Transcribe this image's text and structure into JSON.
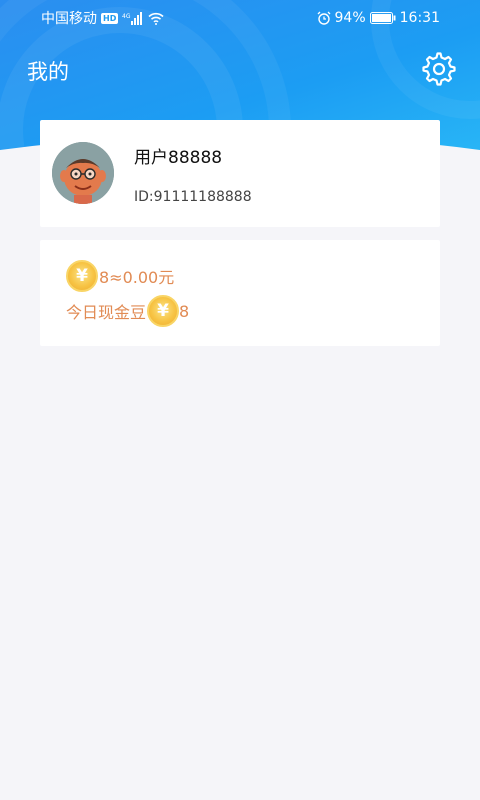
{
  "status_bar": {
    "carrier": "中国移动",
    "hd_badge": "HD",
    "network": "4G",
    "battery": "94%",
    "time": "16:31"
  },
  "header": {
    "title": "我的"
  },
  "user": {
    "name": "用户88888",
    "id": "ID:91111188888"
  },
  "coins": {
    "balance": "8≈0.00元",
    "today_label": "今日现金豆",
    "today_value": "8",
    "coin_symbol": "¥"
  },
  "colors": {
    "header_blue": "#1d9bf0",
    "coin_text": "#e18b54",
    "page_bg": "#f5f5f9"
  }
}
